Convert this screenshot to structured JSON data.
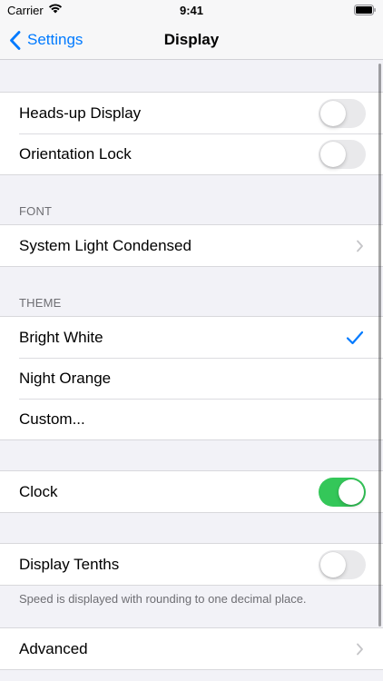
{
  "status_bar": {
    "carrier": "Carrier",
    "time": "9:41"
  },
  "nav": {
    "back_label": "Settings",
    "title": "Display"
  },
  "toggles_group": [
    {
      "label": "Heads-up Display",
      "on": false
    },
    {
      "label": "Orientation Lock",
      "on": false
    }
  ],
  "font_section": {
    "header": "FONT",
    "value": "System Light Condensed"
  },
  "theme_section": {
    "header": "THEME",
    "items": [
      {
        "label": "Bright White",
        "selected": true
      },
      {
        "label": "Night Orange",
        "selected": false
      },
      {
        "label": "Custom...",
        "selected": false
      }
    ]
  },
  "clock": {
    "label": "Clock",
    "on": true
  },
  "tenths": {
    "label": "Display Tenths",
    "on": false,
    "footer": "Speed is displayed with rounding to one decimal place."
  },
  "advanced": {
    "label": "Advanced"
  },
  "colors": {
    "accent": "#007aff",
    "switch_on": "#34c759",
    "switch_off": "#e9e9eb",
    "background": "#f2f2f7"
  },
  "icons": [
    "wifi-icon",
    "battery-icon",
    "chevron-left-icon",
    "chevron-right-icon",
    "checkmark-icon"
  ]
}
